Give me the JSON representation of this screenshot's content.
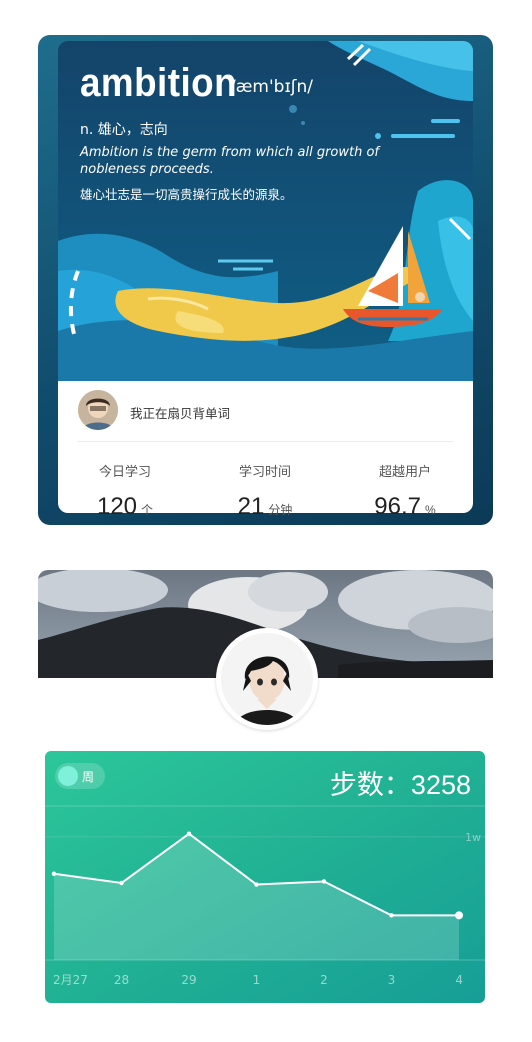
{
  "vocab_card": {
    "word": "ambition",
    "phonetic": "/æm'bɪʃn/",
    "definition": "n. 雄心，志向",
    "example_en": "Ambition is the germ from which all growth of nobleness proceeds.",
    "example_cn": "雄心壮志是一切高贵操行成长的源泉。",
    "share_text": "我正在扇贝背单词",
    "stats": [
      {
        "label": "今日学习",
        "value": "120",
        "unit": "个"
      },
      {
        "label": "学习时间",
        "value": "21",
        "unit": "分钟"
      },
      {
        "label": "超越用户",
        "value": "96.7",
        "unit": "%"
      }
    ]
  },
  "steps_card": {
    "toggle_label": "周",
    "title": "步数：3258",
    "right_axis_label": "1w"
  },
  "chart_data": {
    "type": "area",
    "categories": [
      "2月27",
      "28",
      "29",
      "1",
      "2",
      "3",
      "4"
    ],
    "values": [
      5600,
      5000,
      8200,
      4900,
      5100,
      2900,
      2900
    ],
    "ylim": [
      0,
      10000
    ],
    "grid": true,
    "colors": {
      "line": "#ffffff",
      "fill": "#ffffff"
    }
  }
}
